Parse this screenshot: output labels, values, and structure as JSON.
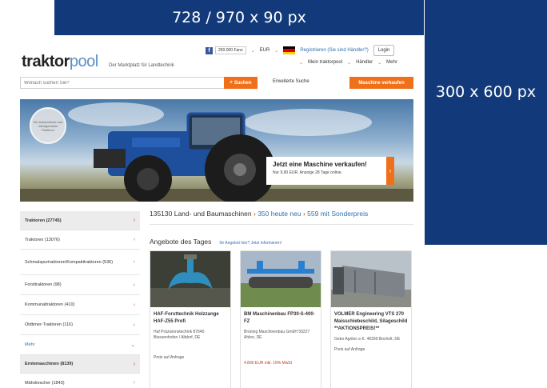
{
  "ads": {
    "top_label": "728 / 970 x 90 px",
    "right_label": "300 x 600 px"
  },
  "header": {
    "logo_main": "traktor",
    "logo_accent": "pool",
    "tagline": "Der Marktplatz für Landtechnik",
    "fb_count": "250.000 Fans",
    "currency": "EUR",
    "register_link": "Registrieren (Sie sind Händler?)",
    "login_label": "Login",
    "nav": [
      "Mein traktorpool",
      "Händler",
      "Mehr"
    ]
  },
  "search": {
    "placeholder": "Wonach suchen Sie?",
    "button_label": "Suchen",
    "advanced_label": "Erweiterte Suche",
    "sell_label": "Maschine verkaufen"
  },
  "hero": {
    "seal_text": "Die bekannteste und meistgenutzte Plattform",
    "promo_title": "Jetzt eine Maschine verkaufen!",
    "promo_sub": "Nur 9,90 EUR. Anzeige 28 Tage online.",
    "promo_arrow": "›"
  },
  "sidebar": {
    "items": [
      {
        "label": "Traktoren (27745)",
        "style": "head",
        "chevron": "›"
      },
      {
        "label": "Traktoren (13076)",
        "style": "normal",
        "chevron": "›"
      },
      {
        "label": "Schmalspurtraktoren/Kompakttraktoren (536)",
        "style": "normal",
        "chevron": "›"
      },
      {
        "label": "Forsttraktoren (98)",
        "style": "normal",
        "chevron": "›"
      },
      {
        "label": "Kommunaltraktoren (410)",
        "style": "normal",
        "chevron": "›"
      },
      {
        "label": "Oldtimer-Traktoren (116)",
        "style": "normal",
        "chevron": "›"
      },
      {
        "label": "Mehr",
        "style": "more",
        "chevron": "⌄"
      },
      {
        "label": "Erntemaschinen (8139)",
        "style": "head",
        "chevron": "›"
      },
      {
        "label": "Mähdrescher (1843)",
        "style": "normal",
        "chevron": "›"
      }
    ]
  },
  "main": {
    "count_prefix": "135130 Land- und Baumaschinen",
    "count_new": "350 heute neu",
    "count_special": "559 mit Sonderpreis",
    "offers_title": "Angebote des Tages",
    "offers_link": "Ihr Angebot hier? Jetzt informieren!",
    "cards": [
      {
        "title": "HAF-Forsttechnik Holzzange HAF-Z55 Profi",
        "dealer": "Haf Präzisionstechnik 87640 Biessenhofen / Altdorf, DE",
        "price": "Preis auf Anfrage"
      },
      {
        "title": "BM Maschinenbau FP30-S-400-FZ",
        "dealer": "Brüning Maschinenbau GmbH 59227 Ahlen, DE",
        "price": "4.890 EUR inkl. 19% MwSt"
      },
      {
        "title": "VOLMER Engineering VTS 270 Maisschiebeschild, Silageschild **AKTIONSPREIS!**",
        "dealer": "Gebo Agritec e.K. 46399 Bocholt, DE",
        "price": "Preis auf Anfrage"
      }
    ]
  },
  "colors": {
    "ad_blue": "#123a7a",
    "accent_orange": "#f07019",
    "link_blue": "#2f6fb5"
  }
}
